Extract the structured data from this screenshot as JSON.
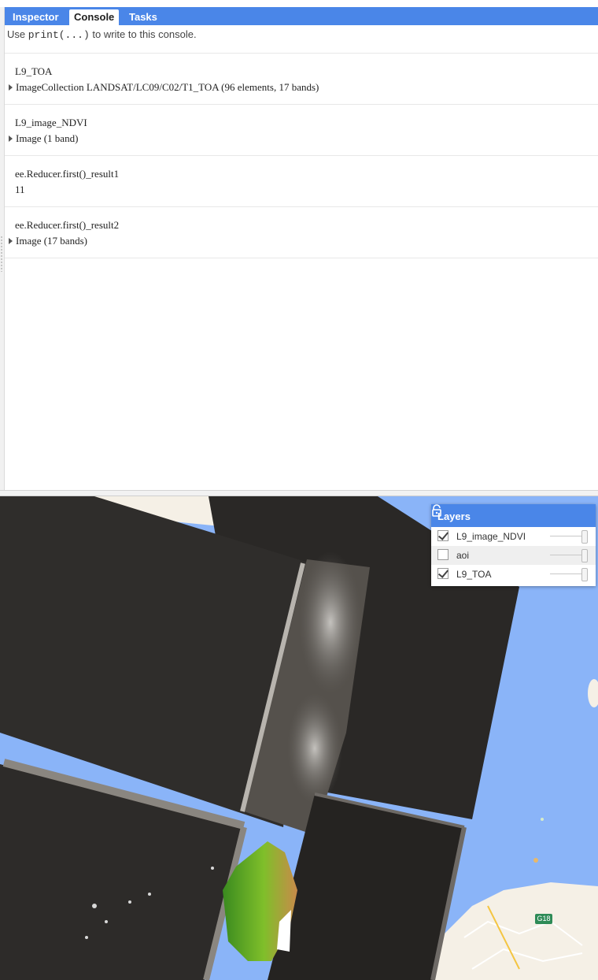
{
  "tabs": [
    {
      "label": "Inspector",
      "active": false
    },
    {
      "label": "Console",
      "active": true
    },
    {
      "label": "Tasks",
      "active": false
    }
  ],
  "console": {
    "hint_prefix": "Use ",
    "hint_code": "print(...)",
    "hint_suffix": " to write to this console.",
    "entries": [
      {
        "label": "L9_TOA",
        "value": "ImageCollection LANDSAT/LC09/C02/T1_TOA (96 elements, 17 bands)",
        "expandable": true
      },
      {
        "label": "L9_image_NDVI",
        "value": "Image (1 band)",
        "expandable": true
      },
      {
        "label": "ee.Reducer.first()_result1",
        "value": "11",
        "expandable": false
      },
      {
        "label": "ee.Reducer.first()_result2",
        "value": "Image (17 bands)",
        "expandable": true
      }
    ]
  },
  "layers_panel": {
    "title": "Layers",
    "lock_icon": "lock-icon",
    "layers": [
      {
        "name": "L9_image_NDVI",
        "checked": true,
        "opacity": 1.0
      },
      {
        "name": "aoi",
        "checked": false,
        "opacity": 1.0
      },
      {
        "name": "L9_TOA",
        "checked": true,
        "opacity": 1.0
      }
    ]
  },
  "map": {
    "road_label": "G18",
    "colors": {
      "water": "#8ab4f8",
      "land": "#f5f0e6",
      "scene": "#2b2a28",
      "accent": "#4a86e8"
    }
  }
}
